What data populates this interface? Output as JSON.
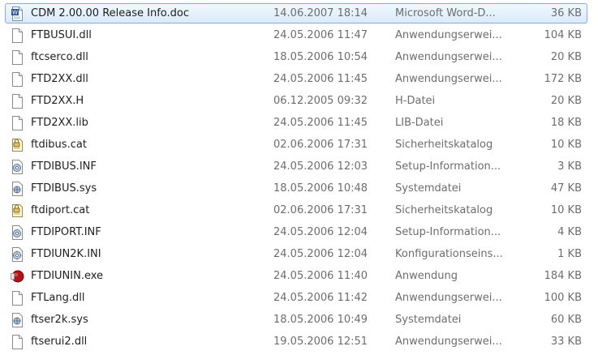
{
  "files": [
    {
      "name": "CDM 2.00.00 Release Info.doc",
      "date": "14.06.2007 18:14",
      "type": "Microsoft Word-D...",
      "size": "36 KB",
      "icon": "word-document-icon",
      "selected": true
    },
    {
      "name": "FTBUSUI.dll",
      "date": "24.05.2006 11:47",
      "type": "Anwendungserwei...",
      "size": "104 KB",
      "icon": "file-icon"
    },
    {
      "name": "ftcserco.dll",
      "date": "18.05.2006 10:54",
      "type": "Anwendungserwei...",
      "size": "20 KB",
      "icon": "file-icon"
    },
    {
      "name": "FTD2XX.dll",
      "date": "24.05.2006 11:45",
      "type": "Anwendungserwei...",
      "size": "172 KB",
      "icon": "file-icon"
    },
    {
      "name": "FTD2XX.H",
      "date": "06.12.2005 09:32",
      "type": "H-Datei",
      "size": "20 KB",
      "icon": "file-icon"
    },
    {
      "name": "FTD2XX.lib",
      "date": "24.05.2006 11:45",
      "type": "LIB-Datei",
      "size": "18 KB",
      "icon": "file-icon"
    },
    {
      "name": "ftdibus.cat",
      "date": "02.06.2006 17:31",
      "type": "Sicherheitskatalog",
      "size": "10 KB",
      "icon": "security-catalog-icon"
    },
    {
      "name": "FTDIBUS.INF",
      "date": "24.05.2006 12:03",
      "type": "Setup-Information...",
      "size": "3 KB",
      "icon": "setup-information-icon"
    },
    {
      "name": "FTDIBUS.sys",
      "date": "18.05.2006 10:48",
      "type": "Systemdatei",
      "size": "47 KB",
      "icon": "system-file-icon"
    },
    {
      "name": "ftdiport.cat",
      "date": "02.06.2006 17:31",
      "type": "Sicherheitskatalog",
      "size": "10 KB",
      "icon": "security-catalog-icon"
    },
    {
      "name": "FTDIPORT.INF",
      "date": "24.05.2006 12:04",
      "type": "Setup-Information...",
      "size": "4 KB",
      "icon": "setup-information-icon"
    },
    {
      "name": "FTDIUN2K.INI",
      "date": "24.05.2006 12:04",
      "type": "Konfigurationseins...",
      "size": "1 KB",
      "icon": "settings-file-icon"
    },
    {
      "name": "FTDIUNIN.exe",
      "date": "24.05.2006 11:40",
      "type": "Anwendung",
      "size": "184 KB",
      "icon": "application-icon"
    },
    {
      "name": "FTLang.dll",
      "date": "24.05.2006 11:42",
      "type": "Anwendungserwei...",
      "size": "100 KB",
      "icon": "file-icon"
    },
    {
      "name": "ftser2k.sys",
      "date": "18.05.2006 10:49",
      "type": "Systemdatei",
      "size": "60 KB",
      "icon": "system-file-icon"
    },
    {
      "name": "ftserui2.dll",
      "date": "19.05.2006 12:51",
      "type": "Anwendungserwei...",
      "size": "33 KB",
      "icon": "file-icon"
    }
  ],
  "colors": {
    "selection_fill": "#d9eafb",
    "selection_border": "#84acdd",
    "secondary_text": "#6d6d6d"
  }
}
